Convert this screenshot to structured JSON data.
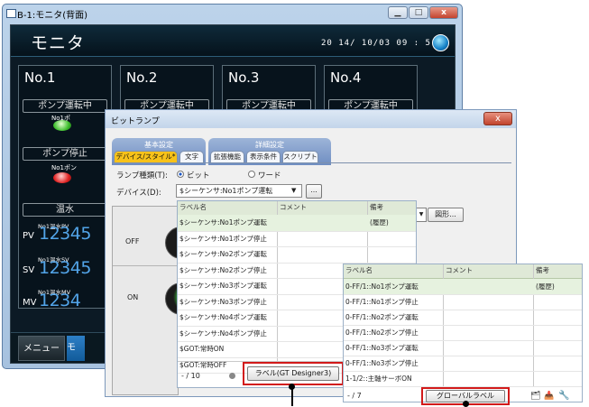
{
  "main_window": {
    "title": "B-1:モニタ(背面)",
    "screen_title": "モニタ",
    "datetime": "20 14/ 10/03 09 : 5 1",
    "panels": [
      {
        "no": "No.1",
        "run": "ポンプ運転中",
        "stop": "ポンプ停止",
        "run_lamp": "No1ポ",
        "stop_lamp": "No1ポン"
      },
      {
        "no": "No.2",
        "run": "ポンプ運転中"
      },
      {
        "no": "No.3",
        "run": "ポンプ運転中"
      },
      {
        "no": "No.4",
        "run": "ポンプ運転中"
      }
    ],
    "temp_label": "温水",
    "side_labels": [
      "PV",
      "SV",
      "MV"
    ],
    "value_tags": [
      "No1温水PV",
      "No1温水SV",
      "No1温水MV"
    ],
    "values": [
      "12345",
      "12345",
      "1234"
    ],
    "menu_button": "メニュー",
    "monitor_button": "モ",
    "controls": {
      "min": "▁",
      "max": "□",
      "close": "x"
    }
  },
  "dialog": {
    "title": "ビットランプ",
    "close": "x",
    "groups": [
      "基本設定",
      "詳細設定"
    ],
    "tabs": [
      "デバイス/スタイル*",
      "文字",
      "拡張機能",
      "表示条件",
      "スクリプト"
    ],
    "lamp_type_label": "ランプ種類(T):",
    "lamp_type_options": [
      "ビット",
      "ワード"
    ],
    "device_label": "デバイス(D):",
    "device_value": "$シーケンサ:No1ポンプ運転",
    "device_dropdown": "▼",
    "browse_button": "...",
    "preview_labels": [
      "OFF",
      "ON"
    ],
    "figure_button": "図形...",
    "figure_dropdown": "▼"
  },
  "label_list_1": {
    "headers": [
      "ラベル名",
      "コメント",
      "備考"
    ],
    "rows": [
      {
        "name": "$シーケンサ:No1ポンプ運転",
        "comment": "",
        "note": "(履歴)"
      },
      {
        "name": "$シーケンサ:No1ポンプ停止",
        "comment": "",
        "note": ""
      },
      {
        "name": "$シーケンサ:No2ポンプ運転",
        "comment": "",
        "note": ""
      },
      {
        "name": "$シーケンサ:No2ポンプ停止",
        "comment": "",
        "note": ""
      },
      {
        "name": "$シーケンサ:No3ポンプ運転",
        "comment": "",
        "note": ""
      },
      {
        "name": "$シーケンサ:No3ポンプ停止",
        "comment": "",
        "note": ""
      },
      {
        "name": "$シーケンサ:No4ポンプ運転",
        "comment": "",
        "note": ""
      },
      {
        "name": "$シーケンサ:No4ポンプ停止",
        "comment": "",
        "note": ""
      },
      {
        "name": "$GOT:常時ON",
        "comment": "",
        "note": ""
      },
      {
        "name": "$GOT:常時OFF",
        "comment": "",
        "note": ""
      }
    ],
    "count": "- / 10",
    "button": "ラベル(GT Designer3)"
  },
  "label_list_2": {
    "headers": [
      "ラベル名",
      "コメント",
      "備考"
    ],
    "rows": [
      {
        "name": "0-FF/1::No1ポンプ運転",
        "comment": "",
        "note": "(履歴)"
      },
      {
        "name": "0-FF/1::No1ポンプ停止",
        "comment": "",
        "note": ""
      },
      {
        "name": "0-FF/1::No2ポンプ運転",
        "comment": "",
        "note": ""
      },
      {
        "name": "0-FF/1::No2ポンプ停止",
        "comment": "",
        "note": ""
      },
      {
        "name": "0-FF/1::No3ポンプ運転",
        "comment": "",
        "note": ""
      },
      {
        "name": "0-FF/1::No3ポンプ停止",
        "comment": "",
        "note": ""
      },
      {
        "name": "1-1/2::主軸サーボON",
        "comment": "",
        "note": ""
      }
    ],
    "count": "- / 7",
    "button": "グローバルラベル",
    "tool_icons": [
      "import-icon",
      "export-icon",
      "wrench-icon"
    ]
  },
  "colors": {
    "highlight": "#d21a1a",
    "tab_active": "#f7c21a",
    "value_blue": "#52a4e8"
  }
}
